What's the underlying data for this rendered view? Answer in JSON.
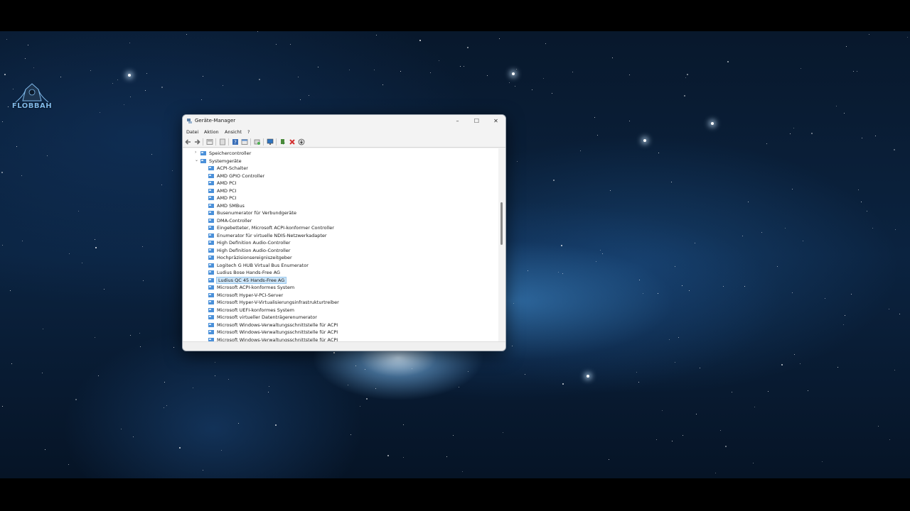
{
  "window": {
    "title": "Geräte-Manager",
    "minimize": "–",
    "maximize": "☐",
    "close": "✕"
  },
  "menu": [
    "Datei",
    "Aktion",
    "Ansicht",
    "?"
  ],
  "toolbar_icons": [
    "back-arrow-icon",
    "forward-arrow-icon",
    "properties-icon",
    "hide-icon",
    "help-icon",
    "view-icon",
    "scan-hardware-icon",
    "monitor-icon",
    "update-driver-icon",
    "uninstall-icon",
    "disable-icon"
  ],
  "tree": {
    "collapsed_category": "Speichercontroller",
    "expanded_category": "Systemgeräte",
    "devices": [
      "ACPI-Schalter",
      "AMD GPIO Controller",
      "AMD PCI",
      "AMD PCI",
      "AMD PCI",
      "AMD SMBus",
      "Busenumerator für Verbundgeräte",
      "DMA-Controller",
      "Eingebetteter, Microsoft ACPI-konformer Controller",
      "Enumerator für virtuelle NDIS-Netzwerkadapter",
      "High Definition Audio-Controller",
      "High Definition Audio-Controller",
      "Hochpräzisionsereigniszeitgeber",
      "Logitech G HUB Virtual Bus Enumerator",
      "Ludius Bose Hands-Free AG",
      "Ludius QC 45 Hands-Free AG",
      "Microsoft ACPI-konformes System",
      "Microsoft Hyper-V-PCI-Server",
      "Microsoft Hyper-V-Virtualisierungsinfrastrukturtreiber",
      "Microsoft UEFI-konformes System",
      "Microsoft virtueller Datenträgerenumerator",
      "Microsoft Windows-Verwaltungsschnittstelle für ACPI",
      "Microsoft Windows-Verwaltungsschnittstelle für ACPI",
      "Microsoft Windows-Verwaltungsschnittstelle für ACPI"
    ],
    "selected_device": "Ludius QC 45 Hands-Free AG"
  },
  "scrollbar": {
    "position": 0.28,
    "visible_fraction": 0.22
  },
  "logo": {
    "text": "FLOBBAH"
  },
  "colors": {
    "selection": "#cce4f7",
    "folder": "#4a90d9"
  }
}
